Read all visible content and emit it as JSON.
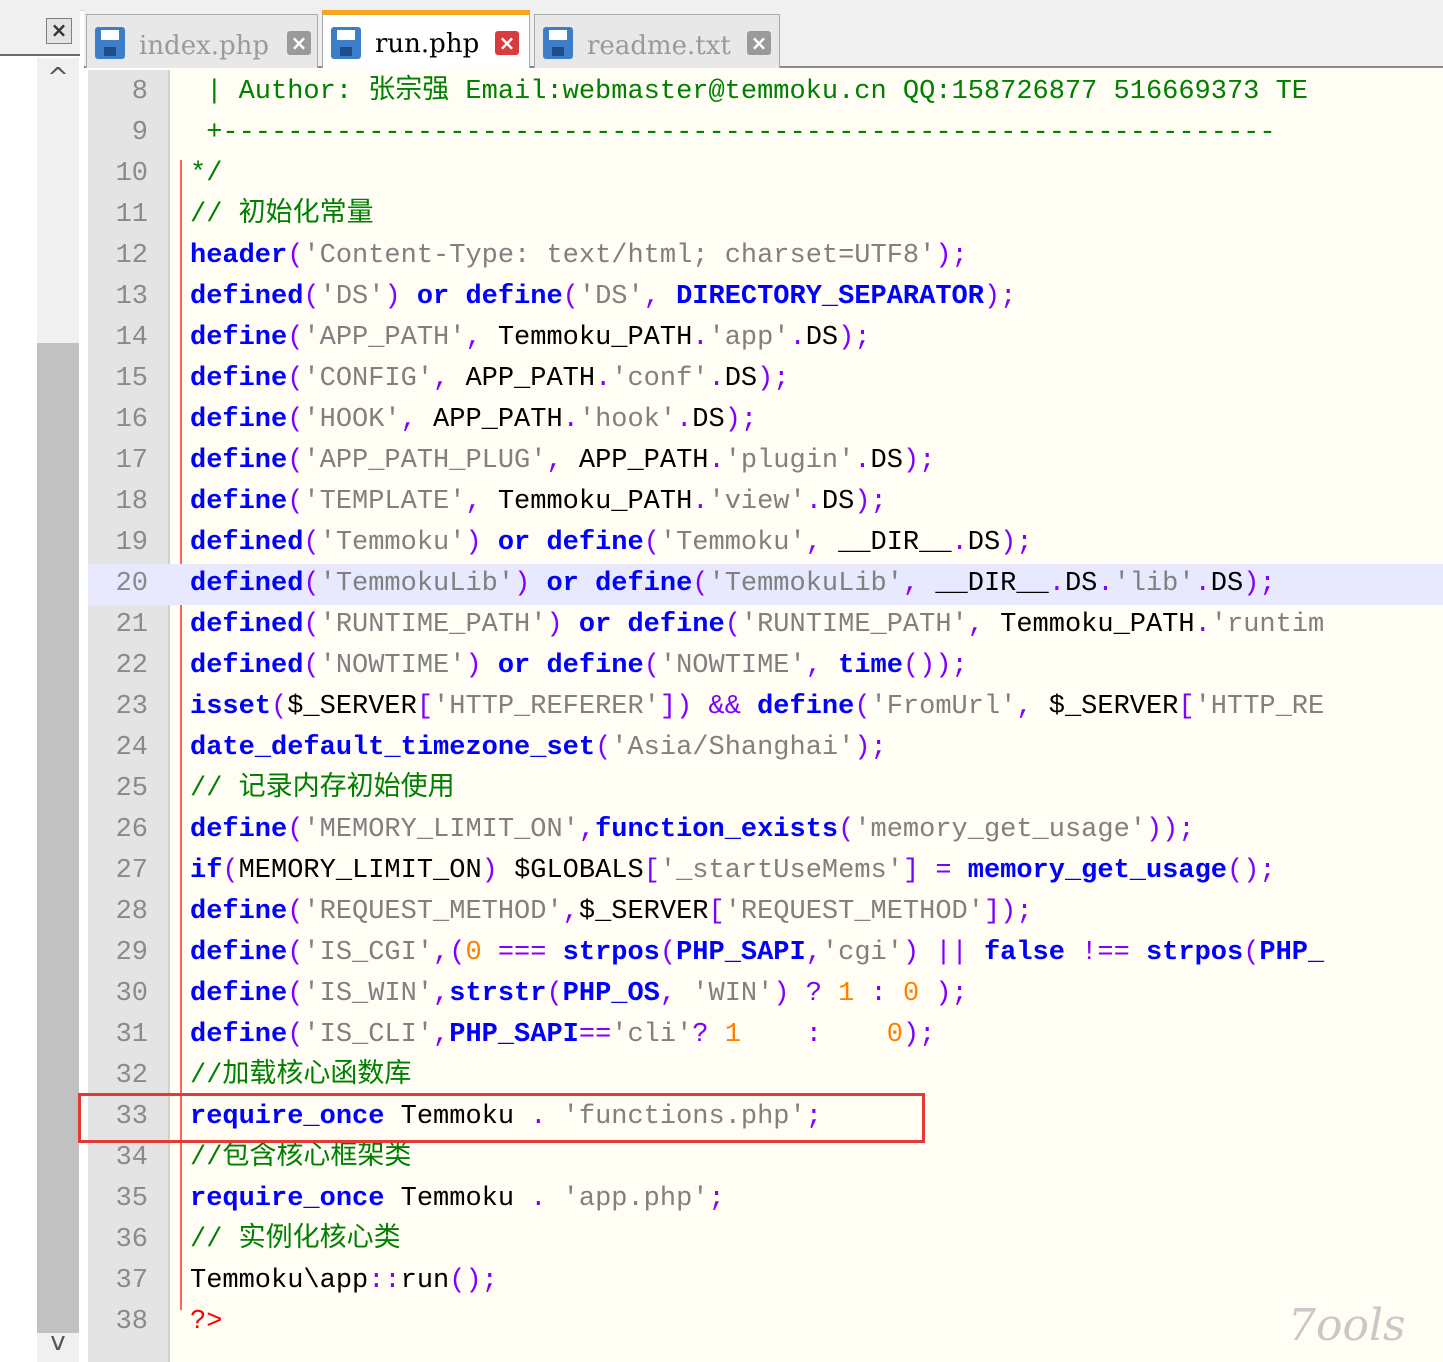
{
  "tabs": [
    {
      "label": "index.php",
      "active": false,
      "icon": "save-disk-icon"
    },
    {
      "label": "run.php",
      "active": true,
      "icon": "save-disk-icon"
    },
    {
      "label": "readme.txt",
      "active": false,
      "icon": "save-disk-icon"
    }
  ],
  "close_doc_symbol": "×",
  "tab_close_symbol": "×",
  "scroll": {
    "up": "^",
    "down": "v"
  },
  "watermark": "7ools",
  "colors": {
    "keyword": "#0000ff",
    "string": "#808080",
    "operator": "#8000ff",
    "comment": "#008000",
    "number": "#ff8000",
    "highlight_box": "#e53935",
    "active_tab_accent": "#f5a623"
  },
  "highlighted_line": 33,
  "current_line": 20,
  "lines": [
    {
      "n": "8",
      "tokens": [
        {
          "t": " | Author: 张宗强 Email:webmaster@temmoku.cn QQ:158726877 516669373 TE",
          "c": "cmt"
        }
      ]
    },
    {
      "n": "9",
      "tokens": [
        {
          "t": " +-----------------------------------------------------------------",
          "c": "cmt"
        }
      ]
    },
    {
      "n": "10",
      "tokens": [
        {
          "t": "*/",
          "c": "cmt"
        }
      ]
    },
    {
      "n": "11",
      "tokens": [
        {
          "t": "// 初始化常量",
          "c": "cmt"
        }
      ]
    },
    {
      "n": "12",
      "tokens": [
        {
          "t": "header",
          "c": "kw"
        },
        {
          "t": "(",
          "c": "op"
        },
        {
          "t": "'Content-Type: text/html; charset=UTF8'",
          "c": "str"
        },
        {
          "t": ");",
          "c": "op"
        }
      ]
    },
    {
      "n": "13",
      "tokens": [
        {
          "t": "defined",
          "c": "kw"
        },
        {
          "t": "(",
          "c": "op"
        },
        {
          "t": "'DS'",
          "c": "str"
        },
        {
          "t": ") ",
          "c": "op"
        },
        {
          "t": "or",
          "c": "kw"
        },
        {
          "t": " ",
          "c": "plain"
        },
        {
          "t": "define",
          "c": "kw"
        },
        {
          "t": "(",
          "c": "op"
        },
        {
          "t": "'DS'",
          "c": "str"
        },
        {
          "t": ", ",
          "c": "op"
        },
        {
          "t": "DIRECTORY_SEPARATOR",
          "c": "kw"
        },
        {
          "t": ");",
          "c": "op"
        }
      ]
    },
    {
      "n": "14",
      "tokens": [
        {
          "t": "define",
          "c": "kw"
        },
        {
          "t": "(",
          "c": "op"
        },
        {
          "t": "'APP_PATH'",
          "c": "str"
        },
        {
          "t": ", ",
          "c": "op"
        },
        {
          "t": "Temmoku_PATH",
          "c": "plain"
        },
        {
          "t": ".",
          "c": "op"
        },
        {
          "t": "'app'",
          "c": "str"
        },
        {
          "t": ".",
          "c": "op"
        },
        {
          "t": "DS",
          "c": "plain"
        },
        {
          "t": ");",
          "c": "op"
        }
      ]
    },
    {
      "n": "15",
      "tokens": [
        {
          "t": "define",
          "c": "kw"
        },
        {
          "t": "(",
          "c": "op"
        },
        {
          "t": "'CONFIG'",
          "c": "str"
        },
        {
          "t": ", ",
          "c": "op"
        },
        {
          "t": "APP_PATH",
          "c": "plain"
        },
        {
          "t": ".",
          "c": "op"
        },
        {
          "t": "'conf'",
          "c": "str"
        },
        {
          "t": ".",
          "c": "op"
        },
        {
          "t": "DS",
          "c": "plain"
        },
        {
          "t": ");",
          "c": "op"
        }
      ]
    },
    {
      "n": "16",
      "tokens": [
        {
          "t": "define",
          "c": "kw"
        },
        {
          "t": "(",
          "c": "op"
        },
        {
          "t": "'HOOK'",
          "c": "str"
        },
        {
          "t": ", ",
          "c": "op"
        },
        {
          "t": "APP_PATH",
          "c": "plain"
        },
        {
          "t": ".",
          "c": "op"
        },
        {
          "t": "'hook'",
          "c": "str"
        },
        {
          "t": ".",
          "c": "op"
        },
        {
          "t": "DS",
          "c": "plain"
        },
        {
          "t": ");",
          "c": "op"
        }
      ]
    },
    {
      "n": "17",
      "tokens": [
        {
          "t": "define",
          "c": "kw"
        },
        {
          "t": "(",
          "c": "op"
        },
        {
          "t": "'APP_PATH_PLUG'",
          "c": "str"
        },
        {
          "t": ", ",
          "c": "op"
        },
        {
          "t": "APP_PATH",
          "c": "plain"
        },
        {
          "t": ".",
          "c": "op"
        },
        {
          "t": "'plugin'",
          "c": "str"
        },
        {
          "t": ".",
          "c": "op"
        },
        {
          "t": "DS",
          "c": "plain"
        },
        {
          "t": ");",
          "c": "op"
        }
      ]
    },
    {
      "n": "18",
      "tokens": [
        {
          "t": "define",
          "c": "kw"
        },
        {
          "t": "(",
          "c": "op"
        },
        {
          "t": "'TEMPLATE'",
          "c": "str"
        },
        {
          "t": ", ",
          "c": "op"
        },
        {
          "t": "Temmoku_PATH",
          "c": "plain"
        },
        {
          "t": ".",
          "c": "op"
        },
        {
          "t": "'view'",
          "c": "str"
        },
        {
          "t": ".",
          "c": "op"
        },
        {
          "t": "DS",
          "c": "plain"
        },
        {
          "t": ");",
          "c": "op"
        }
      ]
    },
    {
      "n": "19",
      "tokens": [
        {
          "t": "defined",
          "c": "kw"
        },
        {
          "t": "(",
          "c": "op"
        },
        {
          "t": "'Temmoku'",
          "c": "str"
        },
        {
          "t": ") ",
          "c": "op"
        },
        {
          "t": "or",
          "c": "kw"
        },
        {
          "t": " ",
          "c": "plain"
        },
        {
          "t": "define",
          "c": "kw"
        },
        {
          "t": "(",
          "c": "op"
        },
        {
          "t": "'Temmoku'",
          "c": "str"
        },
        {
          "t": ", ",
          "c": "op"
        },
        {
          "t": "__DIR__",
          "c": "plain"
        },
        {
          "t": ".",
          "c": "op"
        },
        {
          "t": "DS",
          "c": "plain"
        },
        {
          "t": ");",
          "c": "op"
        }
      ]
    },
    {
      "n": "20",
      "tokens": [
        {
          "t": "defined",
          "c": "kw"
        },
        {
          "t": "(",
          "c": "op"
        },
        {
          "t": "'TemmokuLib'",
          "c": "str"
        },
        {
          "t": ") ",
          "c": "op"
        },
        {
          "t": "or",
          "c": "kw"
        },
        {
          "t": " ",
          "c": "plain"
        },
        {
          "t": "define",
          "c": "kw"
        },
        {
          "t": "(",
          "c": "op"
        },
        {
          "t": "'TemmokuLib'",
          "c": "str"
        },
        {
          "t": ", ",
          "c": "op"
        },
        {
          "t": "__DIR__",
          "c": "plain"
        },
        {
          "t": ".",
          "c": "op"
        },
        {
          "t": "DS",
          "c": "plain"
        },
        {
          "t": ".",
          "c": "op"
        },
        {
          "t": "'lib'",
          "c": "str"
        },
        {
          "t": ".",
          "c": "op"
        },
        {
          "t": "DS",
          "c": "plain"
        },
        {
          "t": ");",
          "c": "op"
        }
      ]
    },
    {
      "n": "21",
      "tokens": [
        {
          "t": "defined",
          "c": "kw"
        },
        {
          "t": "(",
          "c": "op"
        },
        {
          "t": "'RUNTIME_PATH'",
          "c": "str"
        },
        {
          "t": ") ",
          "c": "op"
        },
        {
          "t": "or",
          "c": "kw"
        },
        {
          "t": " ",
          "c": "plain"
        },
        {
          "t": "define",
          "c": "kw"
        },
        {
          "t": "(",
          "c": "op"
        },
        {
          "t": "'RUNTIME_PATH'",
          "c": "str"
        },
        {
          "t": ", ",
          "c": "op"
        },
        {
          "t": "Temmoku_PATH",
          "c": "plain"
        },
        {
          "t": ".",
          "c": "op"
        },
        {
          "t": "'runtim",
          "c": "str"
        }
      ]
    },
    {
      "n": "22",
      "tokens": [
        {
          "t": "defined",
          "c": "kw"
        },
        {
          "t": "(",
          "c": "op"
        },
        {
          "t": "'NOWTIME'",
          "c": "str"
        },
        {
          "t": ") ",
          "c": "op"
        },
        {
          "t": "or",
          "c": "kw"
        },
        {
          "t": " ",
          "c": "plain"
        },
        {
          "t": "define",
          "c": "kw"
        },
        {
          "t": "(",
          "c": "op"
        },
        {
          "t": "'NOWTIME'",
          "c": "str"
        },
        {
          "t": ", ",
          "c": "op"
        },
        {
          "t": "time",
          "c": "kw"
        },
        {
          "t": "());",
          "c": "op"
        }
      ]
    },
    {
      "n": "23",
      "tokens": [
        {
          "t": "isset",
          "c": "kw"
        },
        {
          "t": "(",
          "c": "op"
        },
        {
          "t": "$_SERVER",
          "c": "plain"
        },
        {
          "t": "[",
          "c": "op"
        },
        {
          "t": "'HTTP_REFERER'",
          "c": "str"
        },
        {
          "t": "]) && ",
          "c": "op"
        },
        {
          "t": "define",
          "c": "kw"
        },
        {
          "t": "(",
          "c": "op"
        },
        {
          "t": "'FromUrl'",
          "c": "str"
        },
        {
          "t": ", ",
          "c": "op"
        },
        {
          "t": "$_SERVER",
          "c": "plain"
        },
        {
          "t": "[",
          "c": "op"
        },
        {
          "t": "'HTTP_RE",
          "c": "str"
        }
      ]
    },
    {
      "n": "24",
      "tokens": [
        {
          "t": "date_default_timezone_set",
          "c": "kw"
        },
        {
          "t": "(",
          "c": "op"
        },
        {
          "t": "'Asia/Shanghai'",
          "c": "str"
        },
        {
          "t": ");",
          "c": "op"
        }
      ]
    },
    {
      "n": "25",
      "tokens": [
        {
          "t": "// 记录内存初始使用",
          "c": "cmt"
        }
      ]
    },
    {
      "n": "26",
      "tokens": [
        {
          "t": "define",
          "c": "kw"
        },
        {
          "t": "(",
          "c": "op"
        },
        {
          "t": "'MEMORY_LIMIT_ON'",
          "c": "str"
        },
        {
          "t": ",",
          "c": "op"
        },
        {
          "t": "function_exists",
          "c": "kw"
        },
        {
          "t": "(",
          "c": "op"
        },
        {
          "t": "'memory_get_usage'",
          "c": "str"
        },
        {
          "t": "));",
          "c": "op"
        }
      ]
    },
    {
      "n": "27",
      "tokens": [
        {
          "t": "if",
          "c": "kw"
        },
        {
          "t": "(",
          "c": "op"
        },
        {
          "t": "MEMORY_LIMIT_ON",
          "c": "plain"
        },
        {
          "t": ") ",
          "c": "op"
        },
        {
          "t": "$GLOBALS",
          "c": "plain"
        },
        {
          "t": "[",
          "c": "op"
        },
        {
          "t": "'_startUseMems'",
          "c": "str"
        },
        {
          "t": "] = ",
          "c": "op"
        },
        {
          "t": "memory_get_usage",
          "c": "kw"
        },
        {
          "t": "();",
          "c": "op"
        }
      ]
    },
    {
      "n": "28",
      "tokens": [
        {
          "t": "define",
          "c": "kw"
        },
        {
          "t": "(",
          "c": "op"
        },
        {
          "t": "'REQUEST_METHOD'",
          "c": "str"
        },
        {
          "t": ",",
          "c": "op"
        },
        {
          "t": "$_SERVER",
          "c": "plain"
        },
        {
          "t": "[",
          "c": "op"
        },
        {
          "t": "'REQUEST_METHOD'",
          "c": "str"
        },
        {
          "t": "]);",
          "c": "op"
        }
      ]
    },
    {
      "n": "29",
      "tokens": [
        {
          "t": "define",
          "c": "kw"
        },
        {
          "t": "(",
          "c": "op"
        },
        {
          "t": "'IS_CGI'",
          "c": "str"
        },
        {
          "t": ",(",
          "c": "op"
        },
        {
          "t": "0",
          "c": "num-lit"
        },
        {
          "t": " === ",
          "c": "op"
        },
        {
          "t": "strpos",
          "c": "kw"
        },
        {
          "t": "(",
          "c": "op"
        },
        {
          "t": "PHP_SAPI",
          "c": "kw"
        },
        {
          "t": ",",
          "c": "op"
        },
        {
          "t": "'cgi'",
          "c": "str"
        },
        {
          "t": ") || ",
          "c": "op"
        },
        {
          "t": "false",
          "c": "kw"
        },
        {
          "t": " !== ",
          "c": "op"
        },
        {
          "t": "strpos",
          "c": "kw"
        },
        {
          "t": "(",
          "c": "op"
        },
        {
          "t": "PHP_",
          "c": "kw"
        }
      ]
    },
    {
      "n": "30",
      "tokens": [
        {
          "t": "define",
          "c": "kw"
        },
        {
          "t": "(",
          "c": "op"
        },
        {
          "t": "'IS_WIN'",
          "c": "str"
        },
        {
          "t": ",",
          "c": "op"
        },
        {
          "t": "strstr",
          "c": "kw"
        },
        {
          "t": "(",
          "c": "op"
        },
        {
          "t": "PHP_OS",
          "c": "kw"
        },
        {
          "t": ", ",
          "c": "op"
        },
        {
          "t": "'WIN'",
          "c": "str"
        },
        {
          "t": ") ? ",
          "c": "op"
        },
        {
          "t": "1",
          "c": "num-lit"
        },
        {
          "t": " : ",
          "c": "op"
        },
        {
          "t": "0",
          "c": "num-lit"
        },
        {
          "t": " );",
          "c": "op"
        }
      ]
    },
    {
      "n": "31",
      "tokens": [
        {
          "t": "define",
          "c": "kw"
        },
        {
          "t": "(",
          "c": "op"
        },
        {
          "t": "'IS_CLI'",
          "c": "str"
        },
        {
          "t": ",",
          "c": "op"
        },
        {
          "t": "PHP_SAPI",
          "c": "kw"
        },
        {
          "t": "==",
          "c": "op"
        },
        {
          "t": "'cli'",
          "c": "str"
        },
        {
          "t": "? ",
          "c": "op"
        },
        {
          "t": "1",
          "c": "num-lit"
        },
        {
          "t": "    :    ",
          "c": "op"
        },
        {
          "t": "0",
          "c": "num-lit"
        },
        {
          "t": ");",
          "c": "op"
        }
      ]
    },
    {
      "n": "32",
      "tokens": [
        {
          "t": "//加载核心函数库",
          "c": "cmt"
        }
      ]
    },
    {
      "n": "33",
      "tokens": [
        {
          "t": "require_once",
          "c": "kw"
        },
        {
          "t": " Temmoku ",
          "c": "plain"
        },
        {
          "t": ".",
          "c": "op"
        },
        {
          "t": " ",
          "c": "plain"
        },
        {
          "t": "'functions.php'",
          "c": "str"
        },
        {
          "t": ";",
          "c": "op"
        }
      ]
    },
    {
      "n": "34",
      "tokens": [
        {
          "t": "//包含核心框架类",
          "c": "cmt"
        }
      ]
    },
    {
      "n": "35",
      "tokens": [
        {
          "t": "require_once",
          "c": "kw"
        },
        {
          "t": " Temmoku ",
          "c": "plain"
        },
        {
          "t": ".",
          "c": "op"
        },
        {
          "t": " ",
          "c": "plain"
        },
        {
          "t": "'app.php'",
          "c": "str"
        },
        {
          "t": ";",
          "c": "op"
        }
      ]
    },
    {
      "n": "36",
      "tokens": [
        {
          "t": "// 实例化核心类",
          "c": "cmt"
        }
      ]
    },
    {
      "n": "37",
      "tokens": [
        {
          "t": "Temmoku\\app",
          "c": "plain"
        },
        {
          "t": "::",
          "c": "op"
        },
        {
          "t": "run",
          "c": "plain"
        },
        {
          "t": "();",
          "c": "op"
        }
      ]
    },
    {
      "n": "38",
      "tokens": [
        {
          "t": "?>",
          "c": "php"
        }
      ]
    }
  ]
}
